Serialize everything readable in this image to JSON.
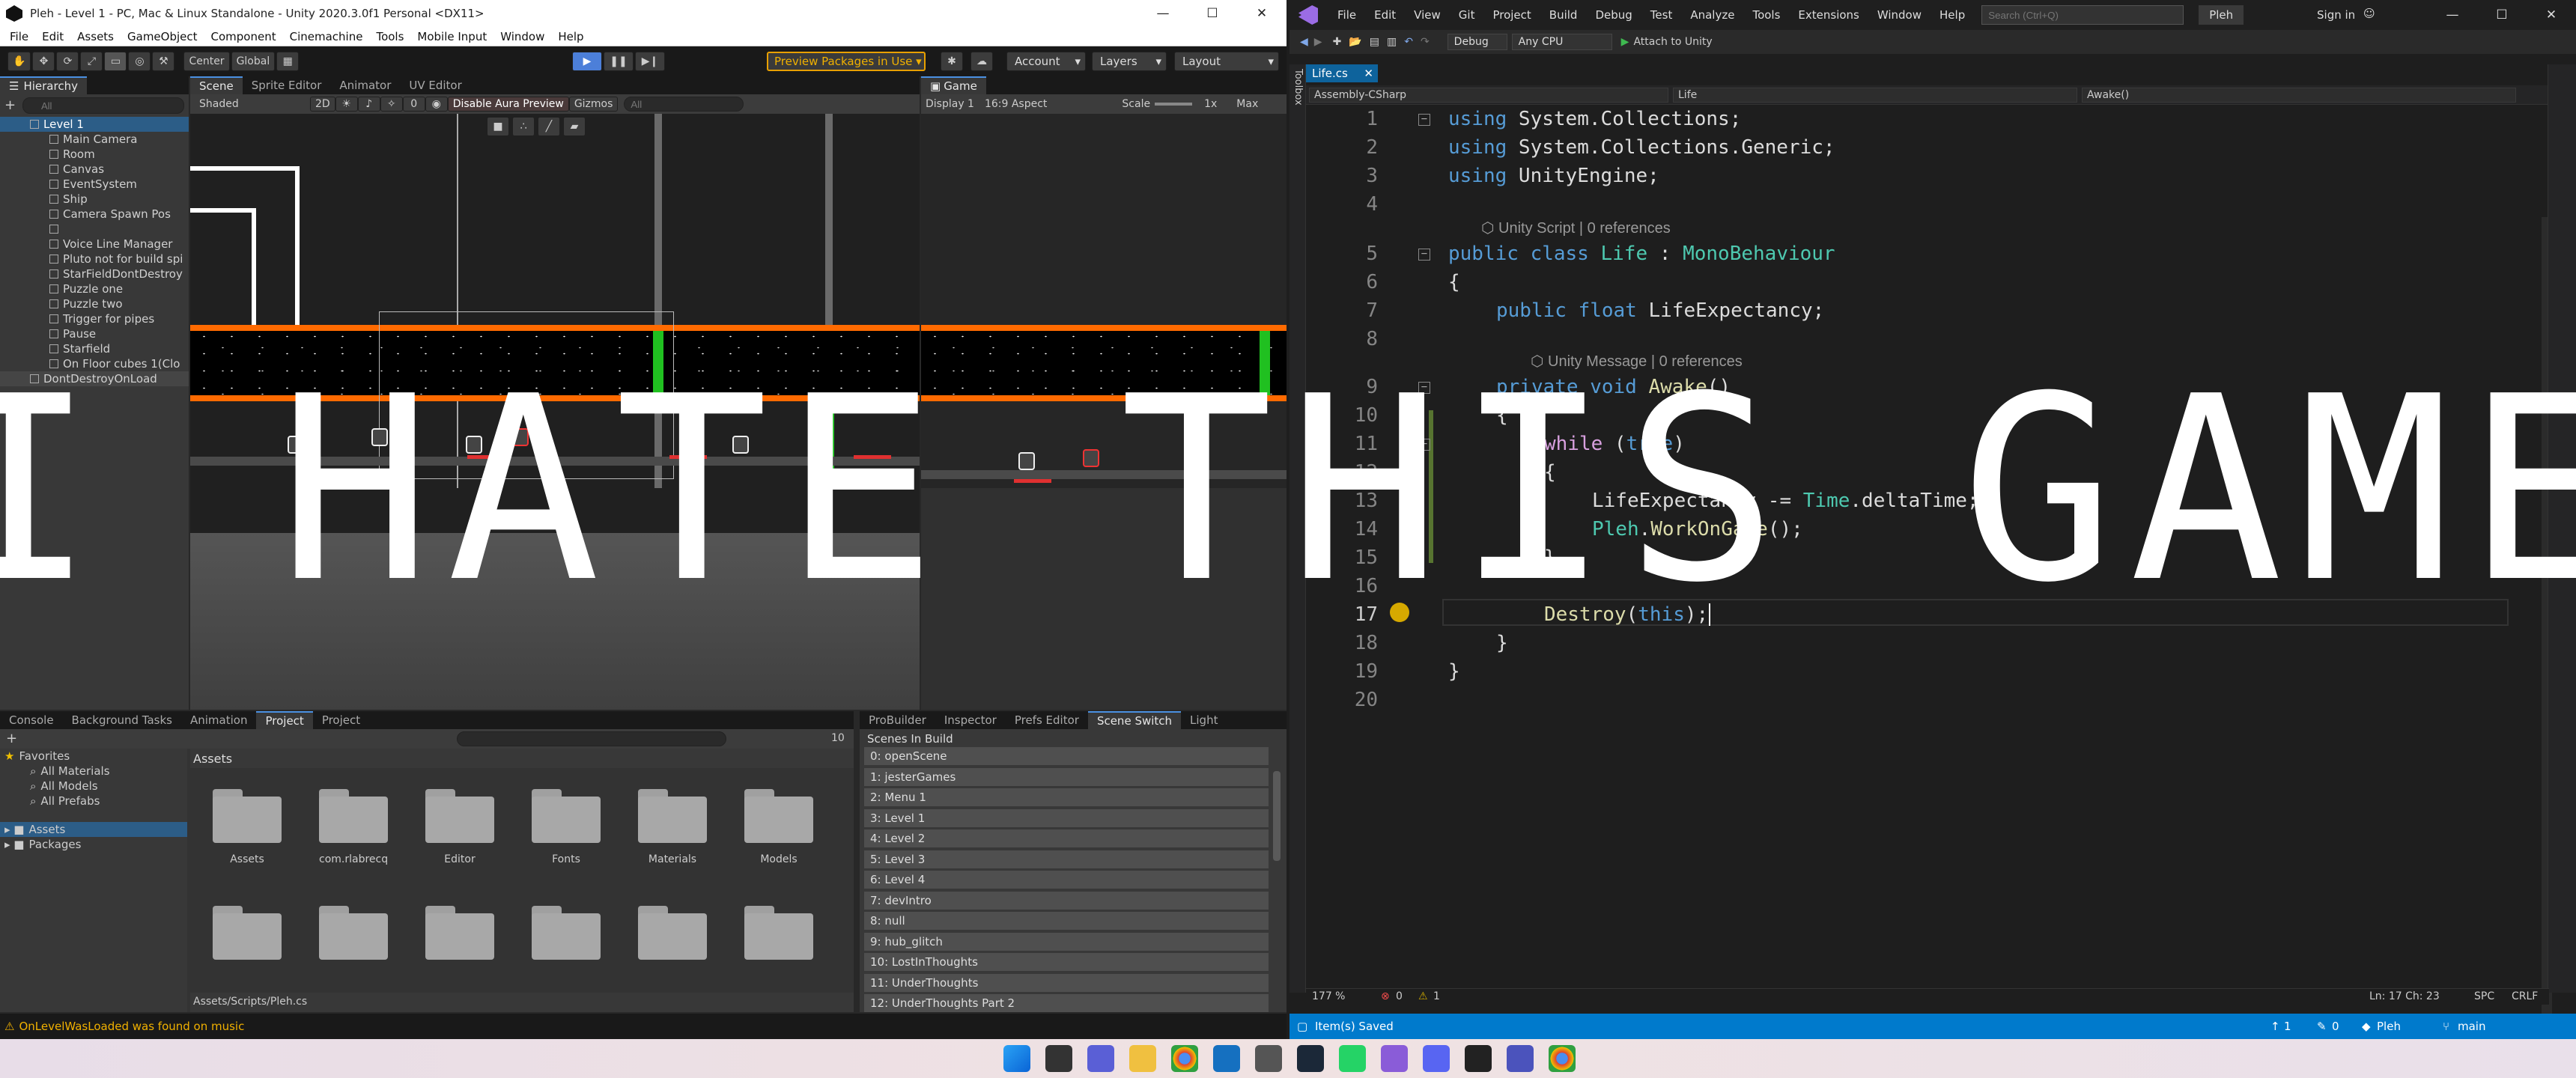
{
  "unity": {
    "title": "Pleh - Level 1 - PC, Mac & Linux Standalone - Unity 2020.3.0f1 Personal <DX11>",
    "menu": [
      "File",
      "Edit",
      "Assets",
      "GameObject",
      "Component",
      "Cinemachine",
      "Tools",
      "Mobile Input",
      "Window",
      "Help"
    ],
    "toolbar": {
      "pivot": "Center",
      "space": "Global",
      "preview_packages": "Preview Packages in Use ▾",
      "account": "Account",
      "layers": "Layers",
      "layout": "Layout"
    },
    "hierarchy": {
      "tab": "Hierarchy",
      "search_placeholder": "All",
      "items": [
        "Level 1",
        "Main Camera",
        "Room",
        "Canvas",
        "EventSystem",
        "Ship",
        "Camera Spawn Pos",
        "",
        "Voice Line Manager",
        "Pluto not for build spi",
        "StarFieldDontDestroy",
        "Puzzle one",
        "Puzzle two",
        "Trigger for pipes",
        "Pause",
        "Starfield",
        "On Floor cubes 1(Clo",
        "DontDestroyOnLoad"
      ]
    },
    "scene": {
      "tabs": [
        "Scene",
        "Sprite Editor",
        "Animator",
        "UV Editor"
      ],
      "shading": "Shaded",
      "mode_2d": "2D",
      "fx_count": "0",
      "aura": "Disable Aura Preview",
      "gizmos": "Gizmos",
      "search_placeholder": "All"
    },
    "game": {
      "tab": "Game",
      "display": "Display 1",
      "aspect": "16:9 Aspect",
      "scale_label": "Scale",
      "scale_value": "1x",
      "max": "Max"
    },
    "bottom_tabs": [
      "Console",
      "Background Tasks",
      "Animation",
      "Project",
      "Project"
    ],
    "project": {
      "favorites": "Favorites",
      "favorite_items": [
        "All Materials",
        "All Models",
        "All Prefabs"
      ],
      "roots": [
        "Assets",
        "Packages"
      ],
      "assets_header": "Assets",
      "folders": [
        "Assets",
        "com.rlabrecque.s...",
        "Editor",
        "Fonts",
        "Materials",
        "Models",
        "",
        "",
        "",
        "",
        "",
        ""
      ],
      "path": "Assets/Scripts/Pleh.cs",
      "icon_count": "10"
    },
    "right_tabs": [
      "ProBuilder",
      "Inspector",
      "Prefs Editor",
      "Scene Switch",
      "Light"
    ],
    "scenes_in_build": {
      "header": "Scenes In Build",
      "items": [
        "0: openScene",
        "1: jesterGames",
        "2: Menu 1",
        "3: Level 1",
        "4: Level 2",
        "5: Level 3",
        "6: Level 4",
        "7: devIntro",
        "8: null",
        "9: hub_glitch",
        "10: LostInThoughts",
        "11: UnderThoughts",
        "12: UnderThoughts Part 2"
      ]
    },
    "status_message": "OnLevelWasLoaded was found on music"
  },
  "vs": {
    "menu": [
      "File",
      "Edit",
      "View",
      "Git",
      "Project",
      "Build",
      "Debug",
      "Test",
      "Analyze",
      "Tools",
      "Extensions",
      "Window",
      "Help"
    ],
    "search_placeholder": "Search (Ctrl+Q)",
    "solution": "Pleh",
    "signin": "Sign in",
    "config": "Debug",
    "platform": "Any CPU",
    "attach": "Attach to Unity",
    "toolbox_label": "Toolbox",
    "file_tab": "Life.cs",
    "nav": {
      "project": "Assembly-CSharp",
      "type": "Life",
      "member": "Awake()"
    },
    "code": {
      "line_numbers": [
        "1",
        "2",
        "3",
        "4",
        "5",
        "6",
        "7",
        "8",
        "9",
        "10",
        "11",
        "12",
        "13",
        "14",
        "15",
        "16",
        "17",
        "18",
        "19",
        "20"
      ],
      "l1": {
        "kw": "using",
        "rest": " System.Collections;"
      },
      "l2": {
        "kw": "using",
        "rest": " System.Collections.Generic;"
      },
      "l3": {
        "kw": "using",
        "rest": " UnityEngine;"
      },
      "lens1": "Unity Script | 0 references",
      "l5": {
        "kw": "public class",
        "name": " Life",
        "sep": " : ",
        "base": "MonoBehaviour"
      },
      "l6": "{",
      "l7": {
        "kw": "public float",
        "rest": " LifeExpectancy;"
      },
      "lens2": "Unity Message | 0 references",
      "l9": {
        "kw": "private void",
        "fn": " Awake",
        "rest": "()"
      },
      "l10": "{",
      "l11": {
        "ctl": "while",
        "rest": " (",
        "kw": "true",
        "end": ")"
      },
      "l12": "{",
      "l13": {
        "a": "LifeExpectancy -= ",
        "ty": "Time",
        "b": ".deltaTime;"
      },
      "l14": {
        "ty": "Pleh",
        "a": ".",
        "fn": "WorkOnGame",
        "b": "();"
      },
      "l15": "}",
      "l17": {
        "fn": "Destroy",
        "a": "(",
        "kw": "this",
        "b": ");"
      },
      "l18": "}",
      "l19": "}"
    },
    "editor_status": {
      "zoom": "177 %",
      "errors": "0",
      "warnings": "1",
      "position": "Ln: 17    Ch: 23",
      "spc": "SPC",
      "eol": "CRLF"
    },
    "status": {
      "message": "Item(s) Saved",
      "up": "1",
      "pencil": "0",
      "repo": "Pleh",
      "branch": "main"
    }
  },
  "overlay_text": "I HATE THIS GAME",
  "colors": {
    "unity_bg": "#282828",
    "vs_accent": "#007acc",
    "orange": "#ff6a00",
    "green": "#20c020"
  }
}
